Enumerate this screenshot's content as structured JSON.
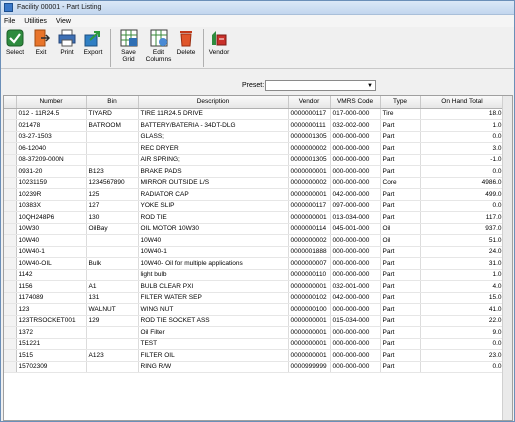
{
  "window": {
    "title": "Facility 00001 - Part Listing"
  },
  "menu": [
    "File",
    "Utilities",
    "View"
  ],
  "toolbar": [
    {
      "label": "Select",
      "icon": "checkmark-icon"
    },
    {
      "label": "Exit",
      "icon": "exit-door-icon"
    },
    {
      "label": "Print",
      "icon": "printer-icon"
    },
    {
      "label": "Export",
      "icon": "export-arrow-icon"
    },
    {
      "label": "Save\nGrid",
      "icon": "save-grid-icon"
    },
    {
      "label": "Edit\nColumns",
      "icon": "edit-columns-icon"
    },
    {
      "label": "Delete",
      "icon": "trash-icon"
    },
    {
      "label": "Vendor",
      "icon": "vendor-icon"
    }
  ],
  "preset": {
    "label": "Preset:",
    "value": ""
  },
  "grid": {
    "columns": [
      "Number",
      "Bin",
      "Description",
      "Vendor",
      "VMRS Code",
      "Type",
      "On Hand Total"
    ],
    "rows": [
      [
        "012 - 11R24.5",
        "TIYARD",
        "TIRE 11R24.5 DRIVE",
        "0000000117",
        "017-000-000",
        "Tire",
        "18.0"
      ],
      [
        "021478",
        "BATROOM",
        "BATTERY/BATERIA - 34DT-DLG",
        "0000000111",
        "032-002-000",
        "Part",
        "1.0"
      ],
      [
        "03-27-1503",
        "",
        "GLASS;",
        "0000001305",
        "000-000-000",
        "Part",
        "0.0"
      ],
      [
        "06-12040",
        "",
        "REC DRYER",
        "0000000002",
        "000-000-000",
        "Part",
        "3.0"
      ],
      [
        "08-37209-000N",
        "",
        "AIR SPRING;",
        "0000001305",
        "000-000-000",
        "Part",
        "-1.0"
      ],
      [
        "0931-20",
        "B123",
        "BRAKE PADS",
        "0000000001",
        "000-000-000",
        "Part",
        "0.0"
      ],
      [
        "10231159",
        "1234567890",
        "MIRROR OUTSIDE L/S",
        "0000000002",
        "000-000-000",
        "Core",
        "4986.0"
      ],
      [
        "10239R",
        "125",
        "RADIATOR CAP",
        "0000000001",
        "042-000-000",
        "Part",
        "499.0"
      ],
      [
        "10383X",
        "127",
        "YOKE SLIP",
        "0000000117",
        "097-000-000",
        "Part",
        "0.0"
      ],
      [
        "10QH248P6",
        "130",
        "ROD TIE",
        "0000000001",
        "013-034-000",
        "Part",
        "117.0"
      ],
      [
        "10W30",
        "OilBay",
        "OIL MOTOR 10W30",
        "0000000114",
        "045-001-000",
        "Oil",
        "937.0"
      ],
      [
        "10W40",
        "",
        "10W40",
        "0000000002",
        "000-000-000",
        "Oil",
        "51.0"
      ],
      [
        "10W40-1",
        "",
        "10W40-1",
        "0000001888",
        "000-000-000",
        "Part",
        "24.0"
      ],
      [
        "10W40-OIL",
        "Bulk",
        "10W40- Oil for multiple applications",
        "0000000007",
        "000-000-000",
        "Part",
        "31.0"
      ],
      [
        "1142",
        "",
        "light bulb",
        "0000000110",
        "000-000-000",
        "Part",
        "1.0"
      ],
      [
        "1156",
        "A1",
        "BULB CLEAR    PXI",
        "0000000001",
        "032-001-000",
        "Part",
        "4.0"
      ],
      [
        "1174089",
        "131",
        "FILTER WATER SEP",
        "0000000102",
        "042-000-000",
        "Part",
        "15.0"
      ],
      [
        "123",
        "WALNUT",
        "WING NUT",
        "0000000100",
        "000-000-000",
        "Part",
        "41.0"
      ],
      [
        "123TRSOCKET001",
        "129",
        "ROD TIE SOCKET ASS",
        "0000000001",
        "015-034-000",
        "Part",
        "22.0"
      ],
      [
        "1372",
        "",
        "Oil Filter",
        "0000000001",
        "000-000-000",
        "Part",
        "9.0"
      ],
      [
        "151221",
        "",
        "TEST",
        "0000000001",
        "000-000-000",
        "Part",
        "0.0"
      ],
      [
        "1515",
        "A123",
        "FILTER OIL",
        "0000000001",
        "000-000-000",
        "Part",
        "23.0"
      ],
      [
        "15702309",
        "",
        "RING R/W",
        "0000999999",
        "000-000-000",
        "Part",
        "0.0"
      ]
    ]
  }
}
